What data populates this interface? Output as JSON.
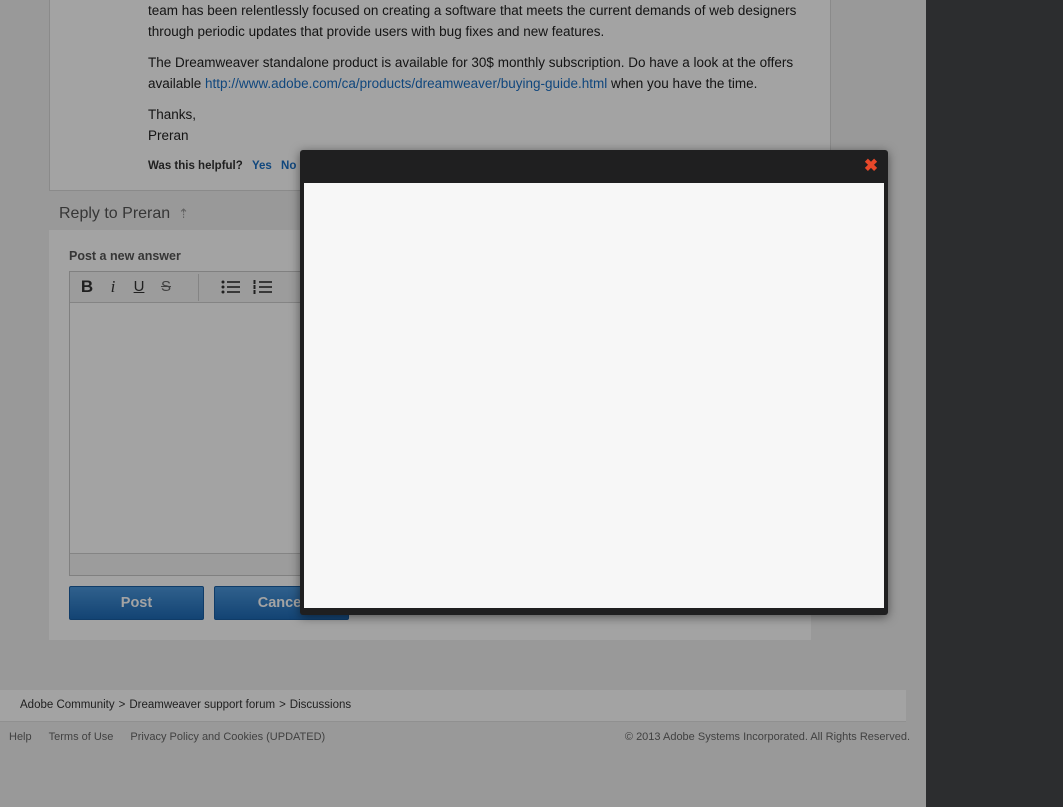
{
  "answer": {
    "para1": "team has been relentlessly focused on creating a software that meets the current demands of web designers through periodic updates that provide users with bug fixes and new features.",
    "para2_before": "The Dreamweaver standalone product is available for 30$ monthly subscription. Do have a look at the offers available ",
    "para2_link": "http://www.adobe.com/ca/products/dreamweaver/buying-guide.html",
    "para2_after": " when you have the time.",
    "thanks": "Thanks,",
    "signature": "Preran",
    "helpful_label": "Was this helpful?",
    "helpful_yes": "Yes",
    "helpful_no": "No"
  },
  "reply": {
    "heading": "Reply to Preran",
    "heading_icon": "arrow-up-icon",
    "post_label": "Post a new answer",
    "toolbar": {
      "bold": "B",
      "italic": "i",
      "underline": "U",
      "strike": "S"
    },
    "post_button": "Post",
    "cancel_button": "Cancel"
  },
  "breadcrumb": {
    "items": [
      "Adobe Community",
      "Dreamweaver support forum",
      "Discussions"
    ],
    "separator": ">"
  },
  "footer": {
    "links": [
      "Help",
      "Terms of Use",
      "Privacy Policy and Cookies (UPDATED)"
    ],
    "copyright": "© 2013 Adobe Systems Incorporated. All Rights Reserved."
  },
  "modal": {
    "close_icon": "close-icon",
    "close_color": "#e8482a"
  },
  "colors": {
    "link": "#1a6fc4",
    "button": "#2a7ac7",
    "side_panel": "#2c2d2f"
  }
}
